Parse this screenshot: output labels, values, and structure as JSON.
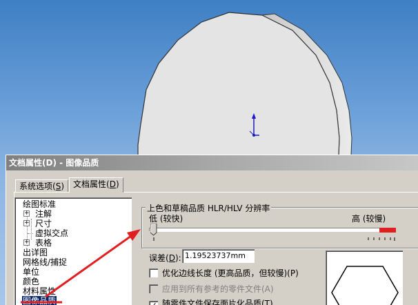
{
  "dialog": {
    "title": "文档属性(D) - 图像品质"
  },
  "tabs": [
    {
      "label_pre": "系统选项(",
      "underline": "S",
      "label_post": ")"
    },
    {
      "label_pre": "文档属性(",
      "underline": "D",
      "label_post": ")"
    }
  ],
  "tree": {
    "items": [
      {
        "label": "绘图标准"
      },
      {
        "label": "注解"
      },
      {
        "label": "尺寸"
      },
      {
        "label": "虚拟交点"
      },
      {
        "label": "表格"
      },
      {
        "label": "出详图"
      },
      {
        "label": "网格线/捕捉"
      },
      {
        "label": "单位"
      },
      {
        "label": "颜色"
      },
      {
        "label": "材料属性"
      },
      {
        "label": "图像品质"
      }
    ]
  },
  "quality": {
    "group_title": "上色和草稿品质 HLR/HLV 分辨率",
    "low_label": "低 (较快)",
    "high_label": "高 (较慢)",
    "slider_value": 0,
    "error_label_pre": "误差(",
    "error_label_underline": "D",
    "error_label_post": "):",
    "error_value": "1.19523737mm"
  },
  "options": [
    {
      "label": "优化边线长度 (更高品质，但较慢)(P)",
      "checked": false,
      "enabled": true
    },
    {
      "label": "应用到所有参考的零件文件(A)",
      "checked": false,
      "enabled": false
    },
    {
      "label": "随零件文件保存面片化品质(T)",
      "checked": true,
      "enabled": true
    }
  ],
  "colors": {
    "accent_red": "#e02020",
    "selection": "#0a246a",
    "dialog_bg": "#d4d0c8"
  }
}
